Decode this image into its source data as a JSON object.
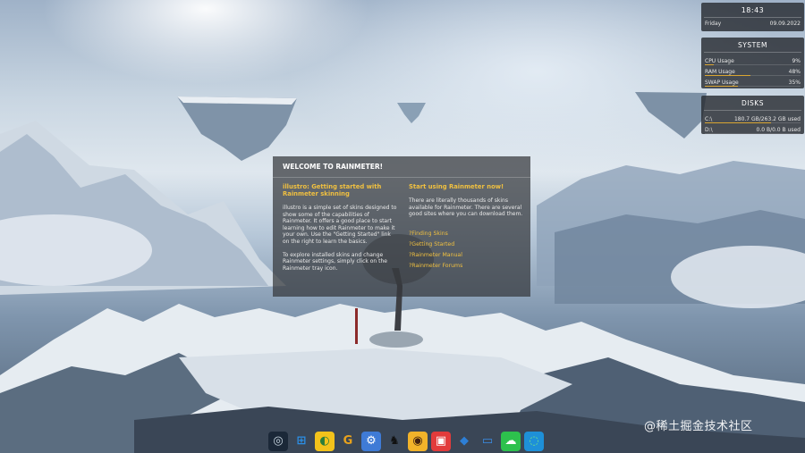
{
  "clock": {
    "time": "18:43",
    "day": "Friday",
    "date": "09.09.2022"
  },
  "system": {
    "title": "SYSTEM",
    "rows": [
      {
        "label": "CPU Usage",
        "value": "9%",
        "level": 0.09
      },
      {
        "label": "RAM Usage",
        "value": "48%",
        "level": 0.48
      },
      {
        "label": "SWAP Usage",
        "value": "35%",
        "level": 0.35
      }
    ]
  },
  "disks": {
    "title": "DISKS",
    "rows": [
      {
        "label": "C:\\",
        "value": "180.7 GB/263.2 GB used",
        "level": 0.69
      },
      {
        "label": "D:\\",
        "value": "0.0 B/0.0 B used",
        "level": 0.0
      }
    ]
  },
  "welcome": {
    "title": "WELCOME TO RAINMETER!",
    "left_heading": "illustro: Getting started with Rainmeter skinning",
    "left_p1": "illustro is a simple set of skins designed to show some of the capabilities of Rainmeter. It offers a good place to start learning how to edit Rainmeter to make it your own. Use the \"Getting Started\" link on the right to learn the basics.",
    "left_p2": "To explore installed skins and change Rainmeter settings, simply click on the Rainmeter tray icon.",
    "right_heading": "Start using Rainmeter now!",
    "right_p1": "There are literally thousands of skins available for Rainmeter. There are several good sites where you can download them.",
    "links": [
      "?Finding Skins",
      "?Getting Started",
      "?Rainmeter Manual",
      "?Rainmeter Forums"
    ]
  },
  "taskbar": {
    "icons": [
      {
        "name": "steam-icon",
        "glyph": "◎",
        "bg": "#1b2838",
        "fg": "#c7d5e0"
      },
      {
        "name": "windows-start-icon",
        "glyph": "⊞",
        "bg": "transparent",
        "fg": "#2b8fe6"
      },
      {
        "name": "app-yellow-icon",
        "glyph": "◐",
        "bg": "#f2c21b",
        "fg": "#2a7d3a"
      },
      {
        "name": "google-chrome-icon",
        "glyph": "G",
        "bg": "transparent",
        "fg": "#e8a21c"
      },
      {
        "name": "settings-app-icon",
        "glyph": "⚙",
        "bg": "#3f7bd6",
        "fg": "#ffffff"
      },
      {
        "name": "qq-penguin-icon",
        "glyph": "♞",
        "bg": "transparent",
        "fg": "#111111"
      },
      {
        "name": "owl-app-icon",
        "glyph": "◉",
        "bg": "#f2b32a",
        "fg": "#402010"
      },
      {
        "name": "red-app-icon",
        "glyph": "▣",
        "bg": "#e23b3b",
        "fg": "#ffffff"
      },
      {
        "name": "dev-tool-icon",
        "glyph": "◆",
        "bg": "transparent",
        "fg": "#2d7fd6"
      },
      {
        "name": "laptop-icon",
        "glyph": "▭",
        "bg": "transparent",
        "fg": "#3a8ee8"
      },
      {
        "name": "wechat-icon",
        "glyph": "☁",
        "bg": "#2dc14d",
        "fg": "#ffffff"
      },
      {
        "name": "edge-browser-icon",
        "glyph": "◌",
        "bg": "#1e90d8",
        "fg": "#6fe08a"
      }
    ]
  },
  "watermark": "@稀土掘金技术社区"
}
